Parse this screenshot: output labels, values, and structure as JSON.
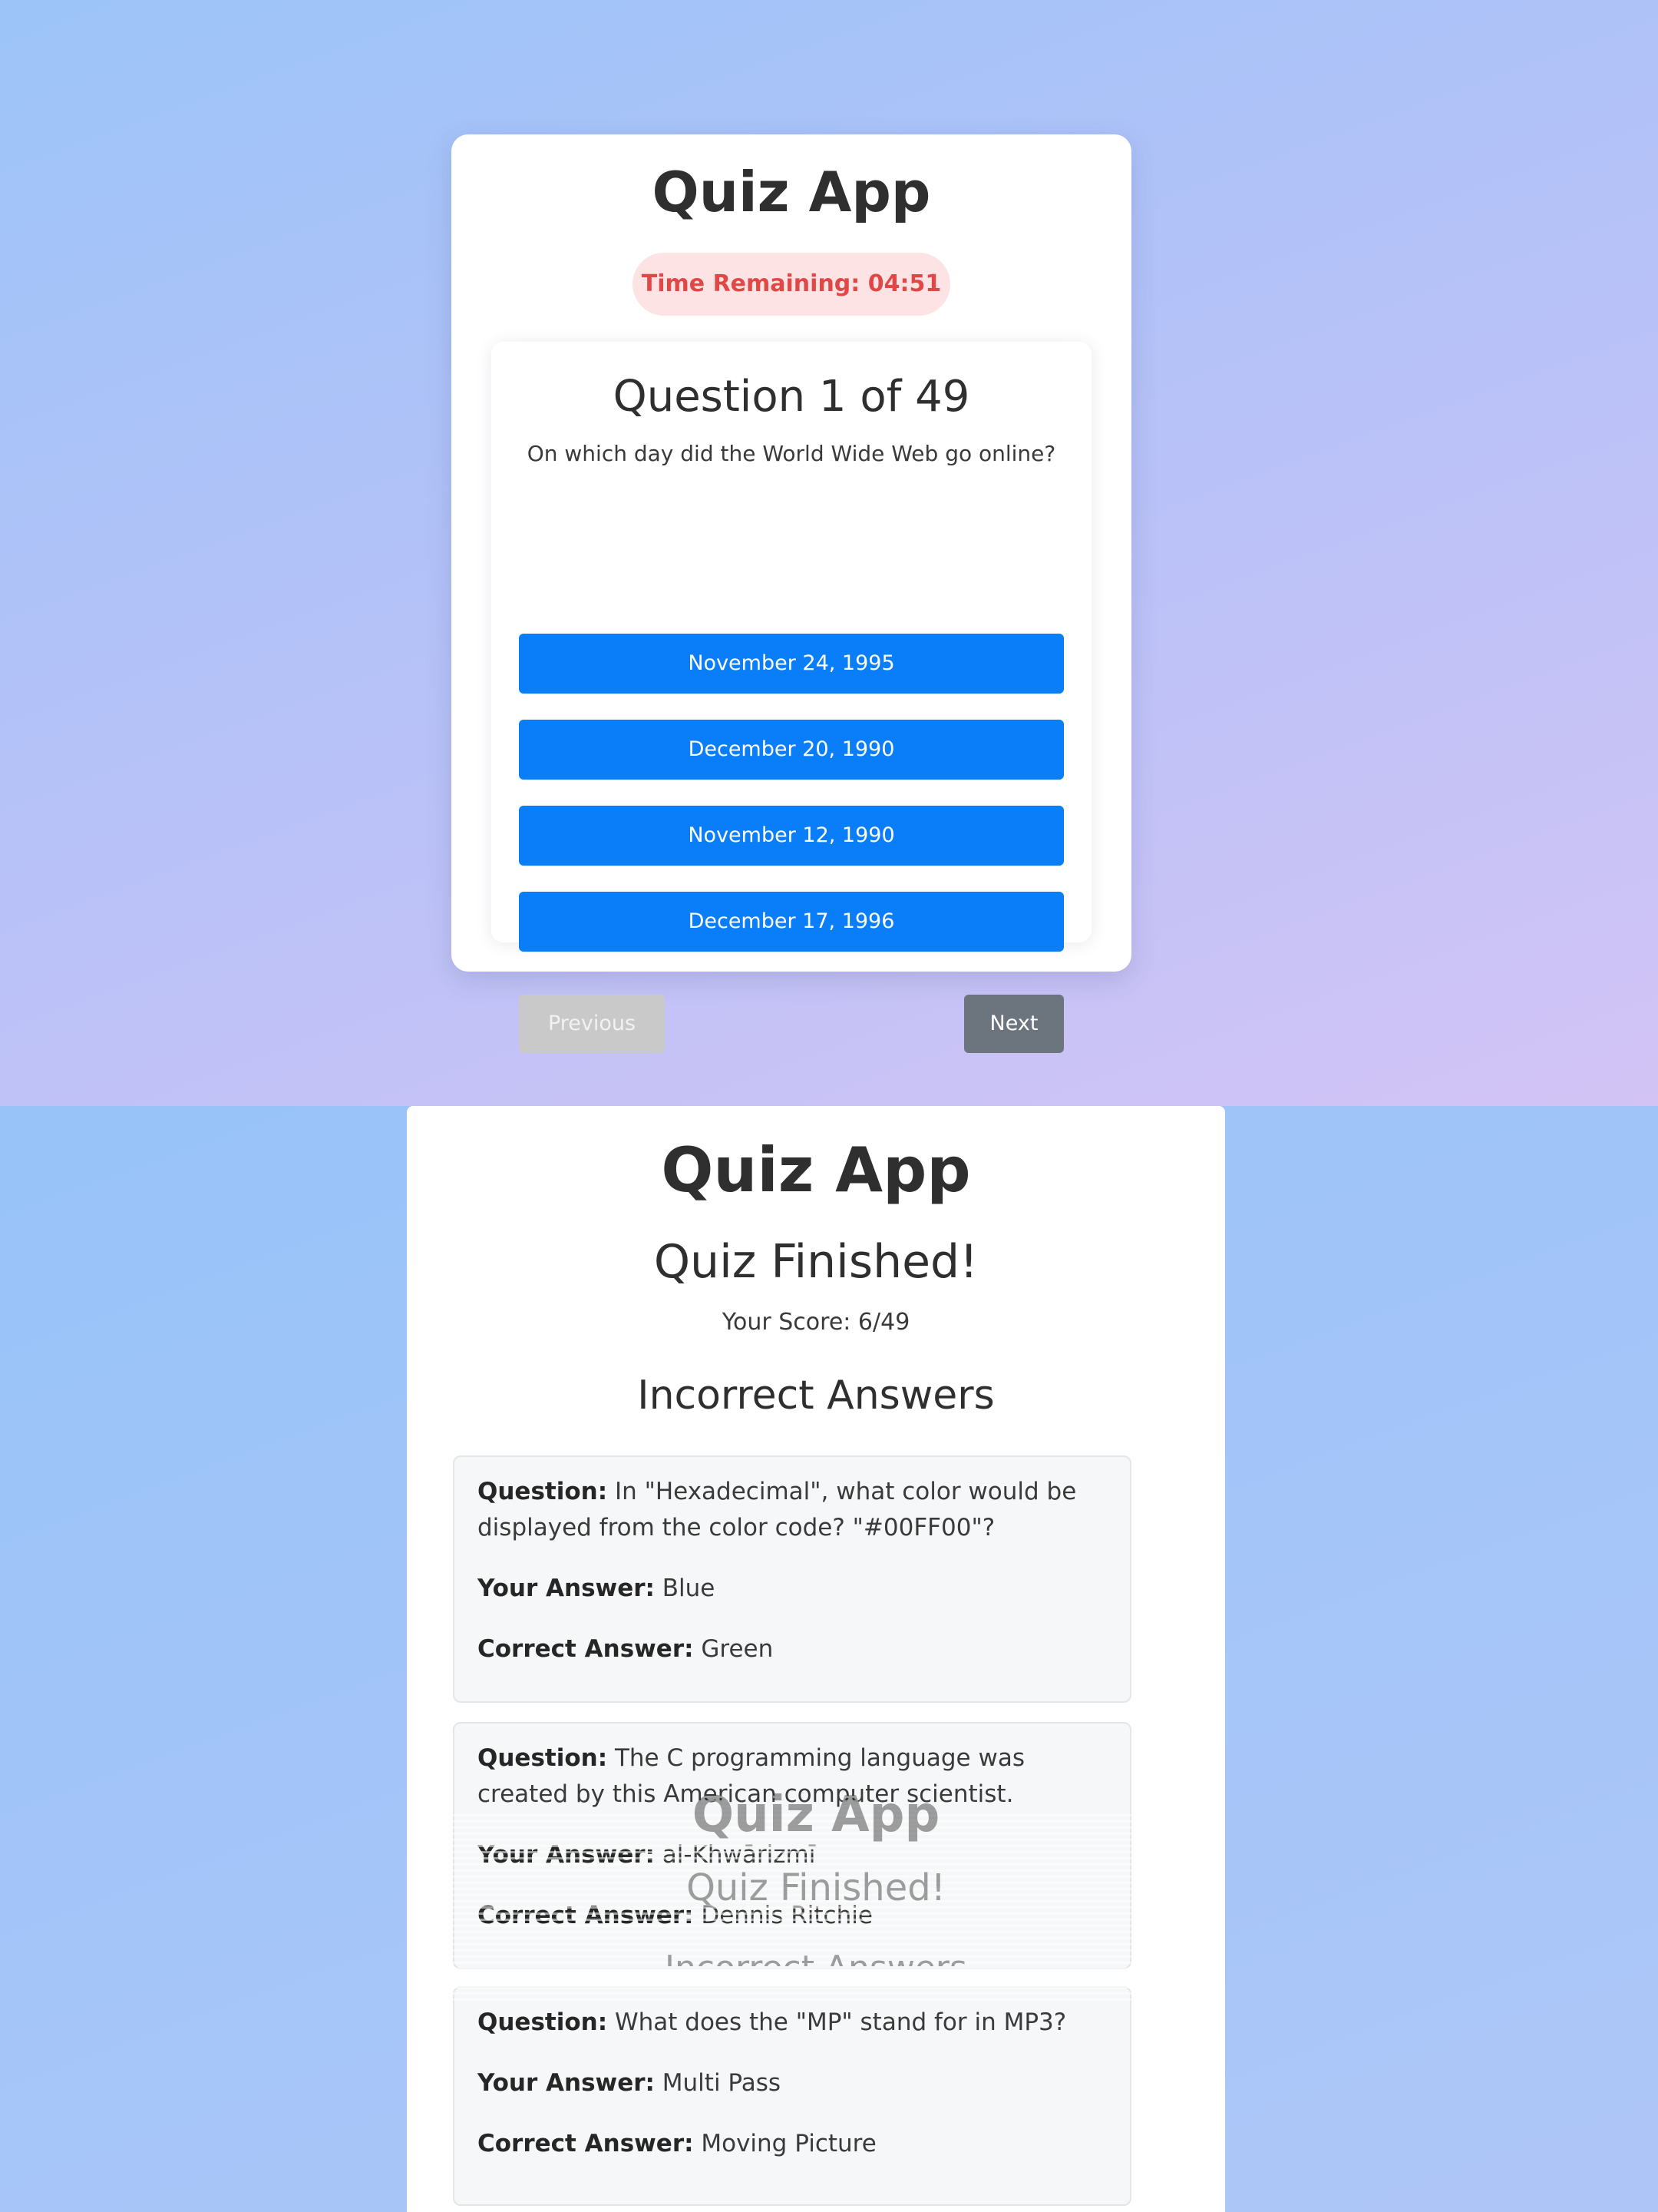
{
  "quiz_screen": {
    "app_title": "Quiz App",
    "timer_text": "Time Remaining: 04:51",
    "question_heading": "Question 1 of 49",
    "question_text": "On which day did the World Wide Web go online?",
    "options": [
      "November 24, 1995",
      "December 20, 1990",
      "November 12, 1990",
      "December 17, 1996"
    ],
    "previous_label": "Previous",
    "next_label": "Next"
  },
  "results_screen": {
    "app_title": "Quiz App",
    "finished_heading": "Quiz Finished!",
    "score_text": "Your Score: 6/49",
    "incorrect_heading": "Incorrect Answers",
    "labels": {
      "question": "Question:",
      "your_answer": "Your Answer:",
      "correct_answer": "Correct Answer:"
    },
    "incorrect_answers": [
      {
        "question": "In \"Hexadecimal\", what color would be displayed from the color code? \"#00FF00\"?",
        "your_answer": "Blue",
        "correct_answer": "Green"
      },
      {
        "question": "The C programming language was created by this American computer scientist.",
        "your_answer": "al-Khwārizmī",
        "correct_answer": "Dennis Ritchie"
      },
      {
        "question": "What does the \"MP\" stand for in MP3?",
        "your_answer": "Multi Pass",
        "correct_answer": "Moving Picture"
      }
    ]
  },
  "colors": {
    "option_button": "#0a7df8",
    "timer_text": "#e04848",
    "timer_background": "#fde3e3",
    "next_button": "#6c757d",
    "previous_button_disabled": "#c9c9c9"
  }
}
